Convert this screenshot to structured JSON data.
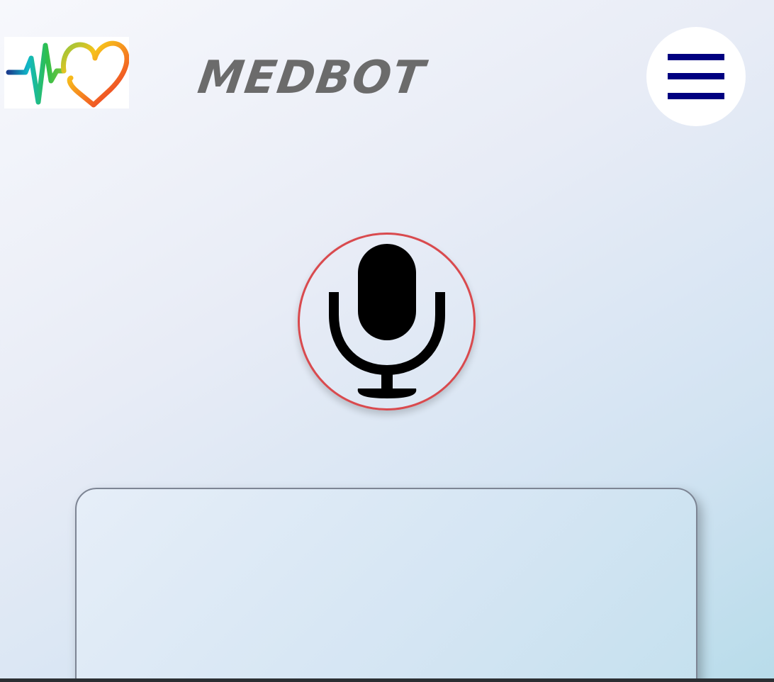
{
  "header": {
    "logo": {
      "icon": "heartbeat-heart-logo"
    },
    "brand_name": "MEDBOT",
    "menu_button": {
      "icon": "hamburger-menu-icon",
      "color": "#000080"
    }
  },
  "voice_input": {
    "icon": "microphone-icon",
    "border_color": "#d94a4e"
  },
  "output_panel": {
    "text": ""
  }
}
